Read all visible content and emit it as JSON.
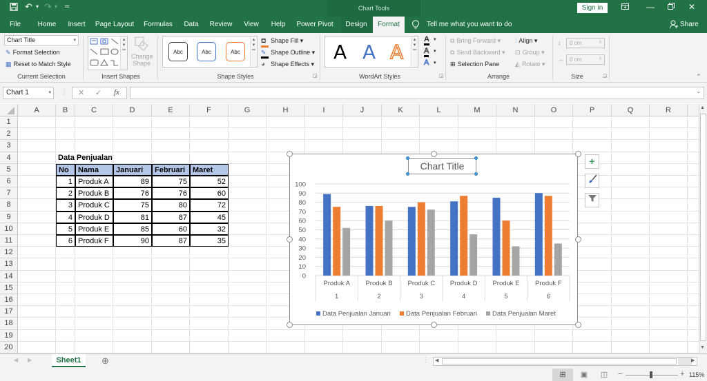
{
  "app": {
    "context_header": "Chart Tools",
    "sign_in": "Sign in",
    "qat": {
      "save": "save-icon",
      "undo": "undo-icon",
      "redo": "redo-icon",
      "customize": "customize-qat-icon"
    },
    "window_buttons": [
      "ribbon-display-icon",
      "minimize-icon",
      "restore-icon",
      "close-icon"
    ]
  },
  "tabs": [
    {
      "label": "File"
    },
    {
      "label": "Home"
    },
    {
      "label": "Insert"
    },
    {
      "label": "Page Layout"
    },
    {
      "label": "Formulas"
    },
    {
      "label": "Data"
    },
    {
      "label": "Review"
    },
    {
      "label": "View"
    },
    {
      "label": "Help"
    },
    {
      "label": "Power Pivot"
    },
    {
      "label": "Design"
    },
    {
      "label": "Format"
    }
  ],
  "tell_me": "Tell me what you want to do",
  "share": "Share",
  "ribbon": {
    "current_selection": {
      "label": "Current Selection",
      "dropdown_value": "Chart Title",
      "format_selection": "Format Selection",
      "reset_style": "Reset to Match Style"
    },
    "insert_shapes": {
      "label": "Insert Shapes",
      "change_shape": "Change",
      "change_shape2": "Shape"
    },
    "shape_styles": {
      "label": "Shape Styles",
      "presets": [
        "Abc",
        "Abc",
        "Abc"
      ],
      "preset_colors": [
        "#404040",
        "#4472c4",
        "#ed7d31"
      ],
      "shape_fill": "Shape Fill",
      "shape_outline": "Shape Outline",
      "shape_effects": "Shape Effects"
    },
    "wordart_styles": {
      "label": "WordArt Styles",
      "presets": [
        "A",
        "A",
        "A"
      ]
    },
    "arrange": {
      "label": "Arrange",
      "bring_forward": "Bring Forward",
      "send_backward": "Send Backward",
      "selection_pane": "Selection Pane",
      "align": "Align",
      "group": "Group",
      "rotate": "Rotate"
    },
    "size": {
      "label": "Size",
      "height": "0 cm",
      "width": "0 cm"
    }
  },
  "formula_bar": {
    "name_box": "Chart 1",
    "fx": "fx",
    "cancel": "✕",
    "enter": "✓",
    "value": ""
  },
  "columns": [
    "A",
    "B",
    "C",
    "D",
    "E",
    "F",
    "G",
    "H",
    "I",
    "J",
    "K",
    "L",
    "M",
    "N",
    "O",
    "P",
    "Q",
    "R"
  ],
  "rows": [
    "1",
    "2",
    "3",
    "4",
    "5",
    "6",
    "7",
    "8",
    "9",
    "10",
    "11",
    "12",
    "13",
    "14",
    "15",
    "16",
    "17",
    "18",
    "19",
    "20"
  ],
  "sheet": {
    "title": "Data Penjualan",
    "headers": [
      "No",
      "Nama",
      "Januari",
      "Februari",
      "Maret"
    ],
    "rows": [
      [
        "1",
        "Produk A",
        "89",
        "75",
        "52"
      ],
      [
        "2",
        "Produk B",
        "76",
        "76",
        "60"
      ],
      [
        "3",
        "Produk C",
        "75",
        "80",
        "72"
      ],
      [
        "4",
        "Produk D",
        "81",
        "87",
        "45"
      ],
      [
        "5",
        "Produk E",
        "85",
        "60",
        "32"
      ],
      [
        "6",
        "Produk F",
        "90",
        "87",
        "35"
      ]
    ]
  },
  "chart_data": {
    "type": "bar",
    "title": "Chart Title",
    "categories": [
      "Produk A",
      "Produk B",
      "Produk C",
      "Produk D",
      "Produk E",
      "Produk F"
    ],
    "category_numbers": [
      "1",
      "2",
      "3",
      "4",
      "5",
      "6"
    ],
    "series": [
      {
        "name": "Data Penjualan Januari",
        "color": "#4472c4",
        "values": [
          89,
          76,
          75,
          81,
          85,
          90
        ]
      },
      {
        "name": "Data Penjualan Februari",
        "color": "#ed7d31",
        "values": [
          75,
          76,
          80,
          87,
          60,
          87
        ]
      },
      {
        "name": "Data Penjualan Maret",
        "color": "#a5a5a5",
        "values": [
          52,
          60,
          72,
          45,
          32,
          35
        ]
      }
    ],
    "yticks": [
      "0",
      "10",
      "20",
      "30",
      "40",
      "50",
      "60",
      "70",
      "80",
      "90",
      "100"
    ],
    "ylim": [
      0,
      100
    ],
    "xlabel": "",
    "ylabel": "",
    "grid": true,
    "legend": "bottom"
  },
  "chart_buttons": {
    "elements": "+",
    "styles": "brush-icon",
    "filters": "filter-icon"
  },
  "sheet_tabs": [
    {
      "label": "Sheet1"
    }
  ],
  "status": {
    "zoom": "115%"
  }
}
